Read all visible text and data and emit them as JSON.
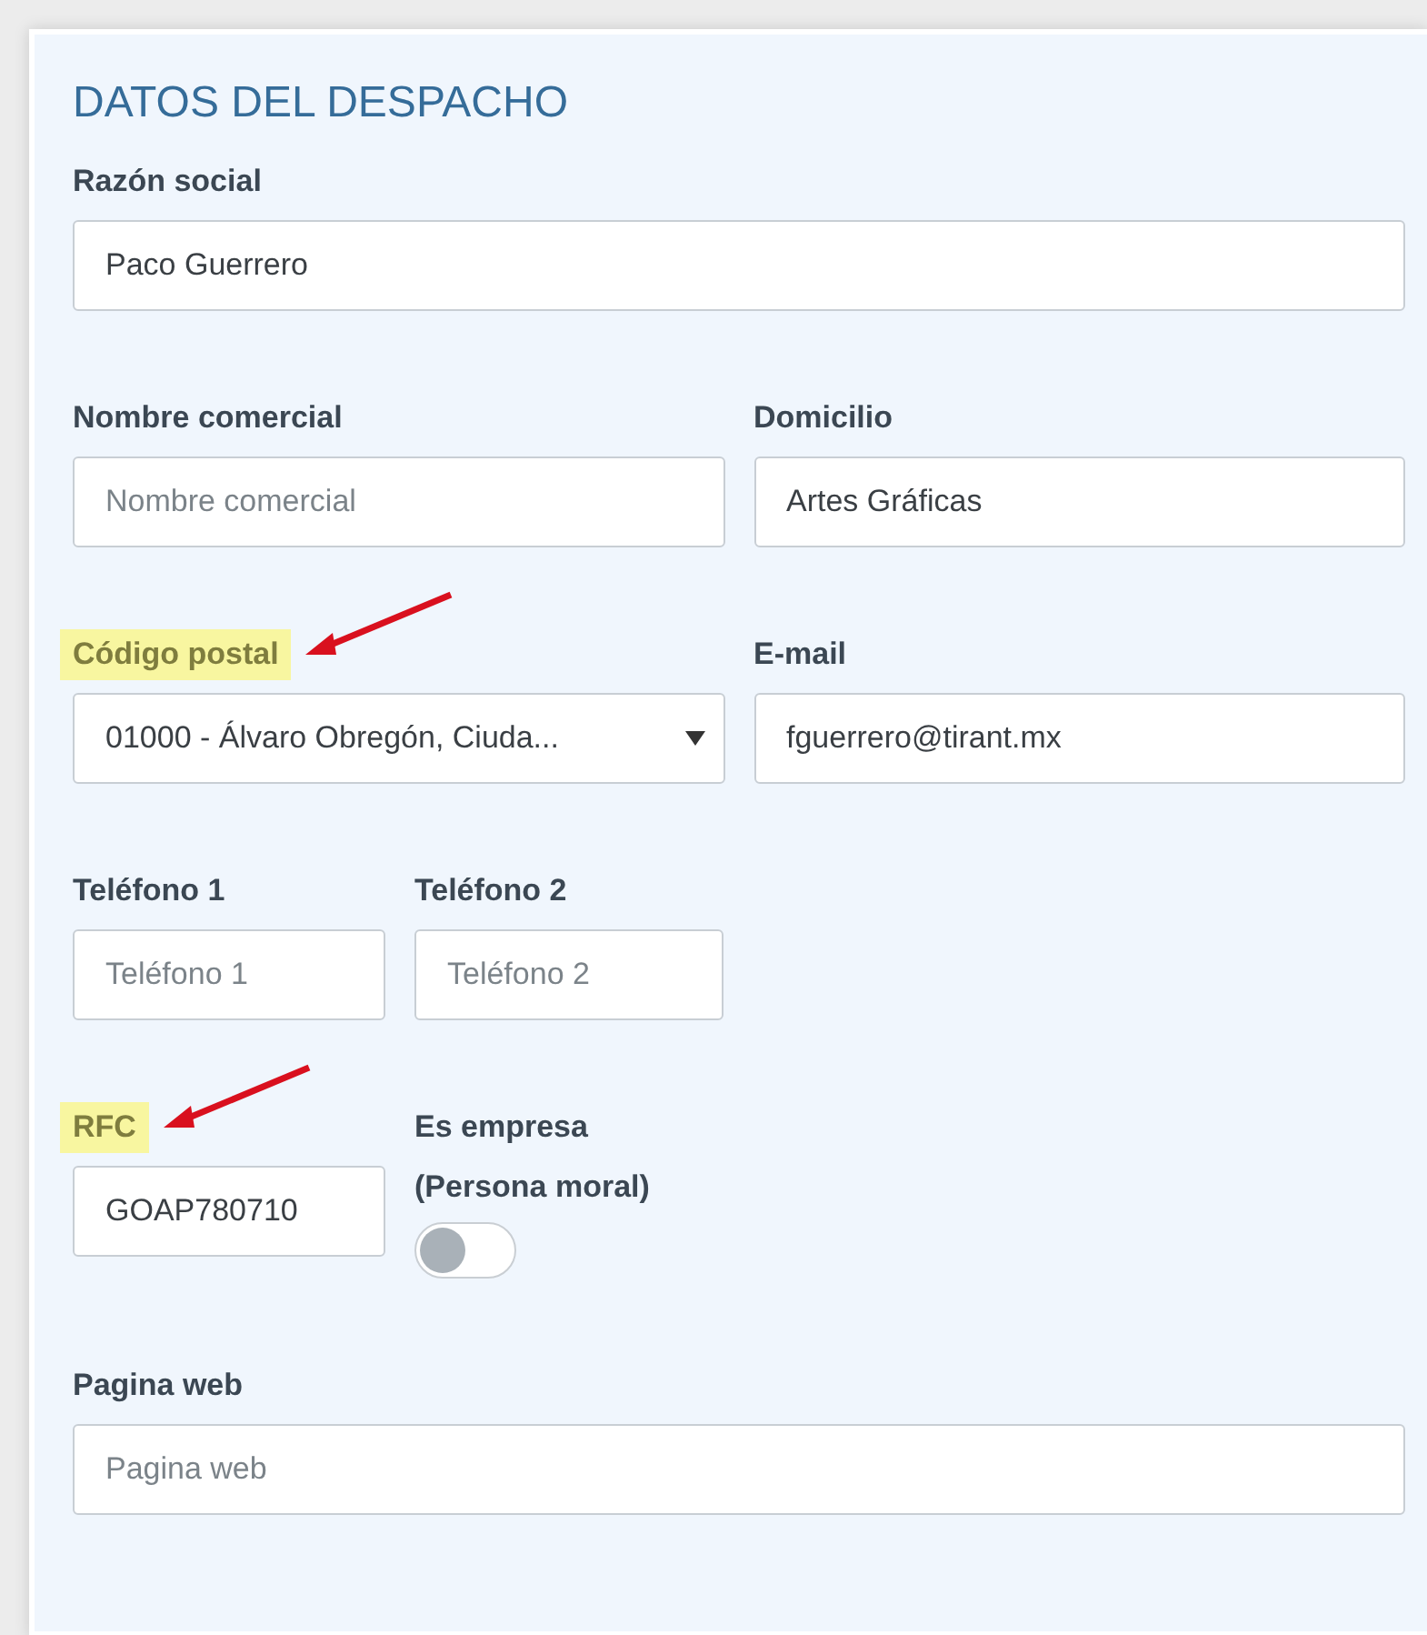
{
  "section": {
    "title": "DATOS DEL DESPACHO"
  },
  "rows": [
    {
      "kind": "full",
      "fields": [
        {
          "kind": "text",
          "label": "Razón social",
          "value": "Paco Guerrero",
          "highlighted": false
        }
      ]
    },
    {
      "kind": "half",
      "fields": [
        {
          "kind": "text",
          "label": "Nombre comercial",
          "placeholder": "Nombre comercial",
          "highlighted": false
        },
        {
          "kind": "text",
          "label": "Domicilio",
          "value": "Artes Gráficas",
          "highlighted": false
        }
      ]
    },
    {
      "kind": "half",
      "fields": [
        {
          "kind": "select",
          "label": "Código postal",
          "value": "01000 - Álvaro Obregón, Ciuda...",
          "highlighted": true
        },
        {
          "kind": "text",
          "label": "E-mail",
          "value": "fguerrero@tirant.mx",
          "highlighted": false
        }
      ]
    },
    {
      "kind": "quarter",
      "fields": [
        {
          "kind": "text",
          "label": "Teléfono 1",
          "placeholder": "Teléfono 1",
          "highlighted": false
        },
        {
          "kind": "text",
          "label": "Teléfono 2",
          "placeholder": "Teléfono 2",
          "highlighted": false
        }
      ]
    },
    {
      "kind": "quarter",
      "fields": [
        {
          "kind": "text",
          "label": "RFC",
          "value": "GOAP780710",
          "highlighted": true
        },
        {
          "kind": "toggle",
          "label_lines": [
            "Es empresa",
            "(Persona moral)"
          ],
          "on": false
        }
      ]
    },
    {
      "kind": "full",
      "fields": [
        {
          "kind": "text",
          "label": "Pagina web",
          "placeholder": "Pagina web",
          "highlighted": false
        }
      ]
    }
  ]
}
